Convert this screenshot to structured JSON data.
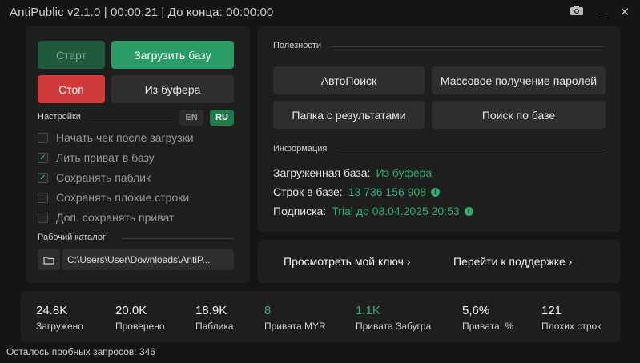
{
  "titlebar": {
    "title": "AntiPublic v2.1.0 | 00:00:21 | До конца: 00:00:00",
    "icons": [
      "camera-icon",
      "minimize-icon",
      "close-icon"
    ]
  },
  "controls": {
    "start_label": "Старт",
    "load_base_label": "Загрузить базу",
    "stop_label": "Стоп",
    "from_clipboard_label": "Из буфера"
  },
  "settings": {
    "heading": "Настройки",
    "lang_en": "EN",
    "lang_ru": "RU",
    "active_lang": "RU",
    "options": [
      {
        "label": "Начать чек после загрузки",
        "checked": false
      },
      {
        "label": "Лить приват в базу",
        "checked": true
      },
      {
        "label": "Сохранять паблик",
        "checked": true
      },
      {
        "label": "Сохранять плохие строки",
        "checked": false
      },
      {
        "label": "Доп. сохранять приват",
        "checked": false
      }
    ]
  },
  "workdir": {
    "heading": "Рабочий каталог",
    "path": "C:\\Users\\User\\Downloads\\AntiP..."
  },
  "utilities": {
    "heading": "Полезности",
    "buttons": [
      "АвтоПоиск",
      "Массовое получение паролей",
      "Папка с результатами",
      "Поиск по базе"
    ]
  },
  "info": {
    "heading": "Информация",
    "loaded_base_key": "Загруженная база:",
    "loaded_base_val": "Из буфера",
    "lines_key": "Строк в базе:",
    "lines_val": "13 736 156 908",
    "subscription_key": "Подписка:",
    "subscription_val": "Trial до 08.04.2025 20:53"
  },
  "links": {
    "view_key": "Просмотреть мой ключ ›",
    "support": "Перейти к поддержке ›"
  },
  "stats": [
    {
      "value": "24.8K",
      "label": "Загружено",
      "highlight": false
    },
    {
      "value": "20.0K",
      "label": "Проверено",
      "highlight": false
    },
    {
      "value": "18.9K",
      "label": "Паблика",
      "highlight": false
    },
    {
      "value": "8",
      "label": "Привата MYR",
      "highlight": true
    },
    {
      "value": "1.1K",
      "label": "Привата Забугра",
      "highlight": true
    },
    {
      "value": "5,6%",
      "label": "Привата, %",
      "highlight": false
    },
    {
      "value": "121",
      "label": "Плохих строк",
      "highlight": false
    }
  ],
  "footer": {
    "trial_requests": "Осталось пробных запросов: 346"
  },
  "colors": {
    "accent_green": "#2a9d66",
    "stop_red": "#d13a3a",
    "value_green": "#2fae70"
  }
}
